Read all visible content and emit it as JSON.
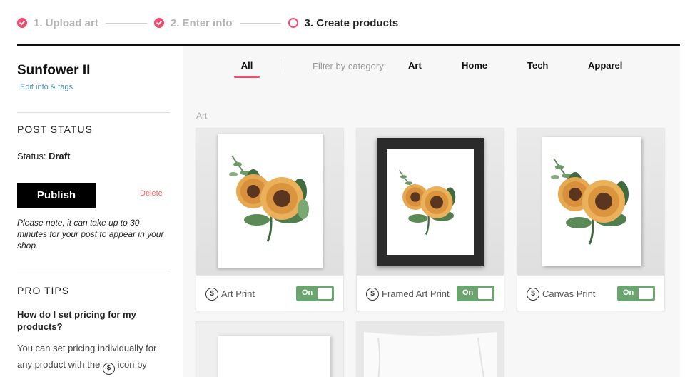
{
  "stepper": {
    "steps": [
      {
        "label": "1. Upload art",
        "state": "done"
      },
      {
        "label": "2. Enter info",
        "state": "done"
      },
      {
        "label": "3. Create products",
        "state": "active"
      }
    ]
  },
  "sidebar": {
    "product_title": "Sunfower II",
    "edit_link": "Edit info & tags",
    "post_status_heading": "POST STATUS",
    "status_label": "Status:",
    "status_value": "Draft",
    "publish_label": "Publish",
    "delete_label": "Delete",
    "note": "Please note, it can take up to 30 minutes for your post to appear in your shop.",
    "pro_tips_heading": "PRO TIPS",
    "tip_question": "How do I set pricing for my products?",
    "tip_answer_before": "You can set pricing individually for any product with the",
    "tip_answer_after": "icon by clicking through to edit them"
  },
  "filter": {
    "all_label": "All",
    "filter_by_label": "Filter by category:",
    "categories": [
      "Art",
      "Home",
      "Tech",
      "Apparel"
    ]
  },
  "main": {
    "section_label": "Art",
    "products": [
      {
        "name": "Art Print",
        "toggle": "On",
        "enabled": true
      },
      {
        "name": "Framed Art Print",
        "toggle": "On",
        "enabled": true
      },
      {
        "name": "Canvas Print",
        "toggle": "On",
        "enabled": true
      }
    ]
  },
  "icons": {
    "price": "dollar-circle-icon",
    "done": "check-circle-icon",
    "active": "ring-icon"
  },
  "colors": {
    "accent": "#ee4f6e",
    "toggle_on": "#6aa46f",
    "link": "#4c8fa8",
    "delete": "#ee6b6b"
  }
}
